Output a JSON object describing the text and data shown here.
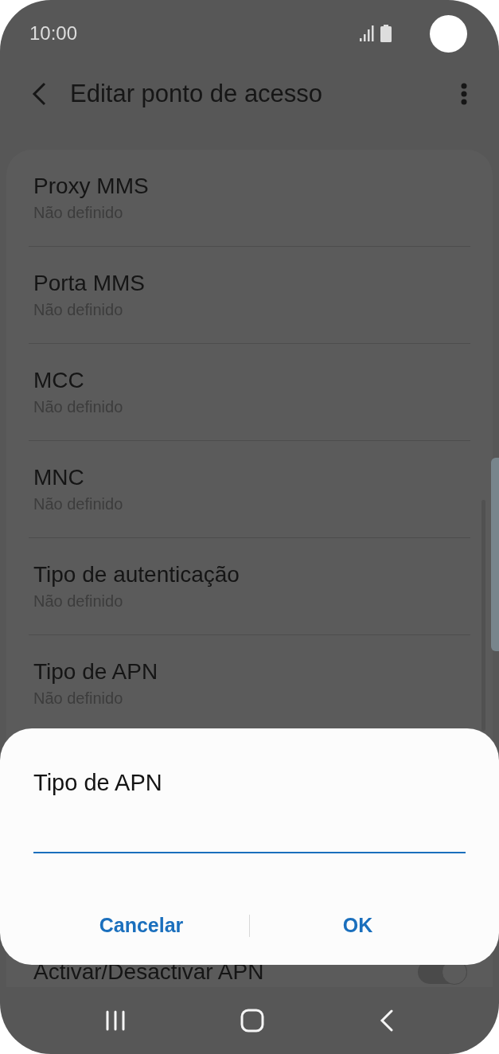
{
  "status_bar": {
    "time": "10:00"
  },
  "header": {
    "title": "Editar ponto de acesso"
  },
  "settings": [
    {
      "kind": "text",
      "title": "Proxy MMS",
      "value": "Não definido"
    },
    {
      "kind": "text",
      "title": "Porta MMS",
      "value": "Não definido"
    },
    {
      "kind": "text",
      "title": "MCC",
      "value": "Não definido"
    },
    {
      "kind": "text",
      "title": "MNC",
      "value": "Não definido"
    },
    {
      "kind": "text",
      "title": "Tipo de autenticação",
      "value": "Não definido"
    },
    {
      "kind": "text",
      "title": "Tipo de APN",
      "value": "Não definido"
    },
    {
      "kind": "toggle",
      "title": "Activar/Desactivar APN",
      "on": true
    }
  ],
  "dialog": {
    "title": "Tipo de APN",
    "buttons": [
      "Cancelar",
      "OK"
    ]
  }
}
